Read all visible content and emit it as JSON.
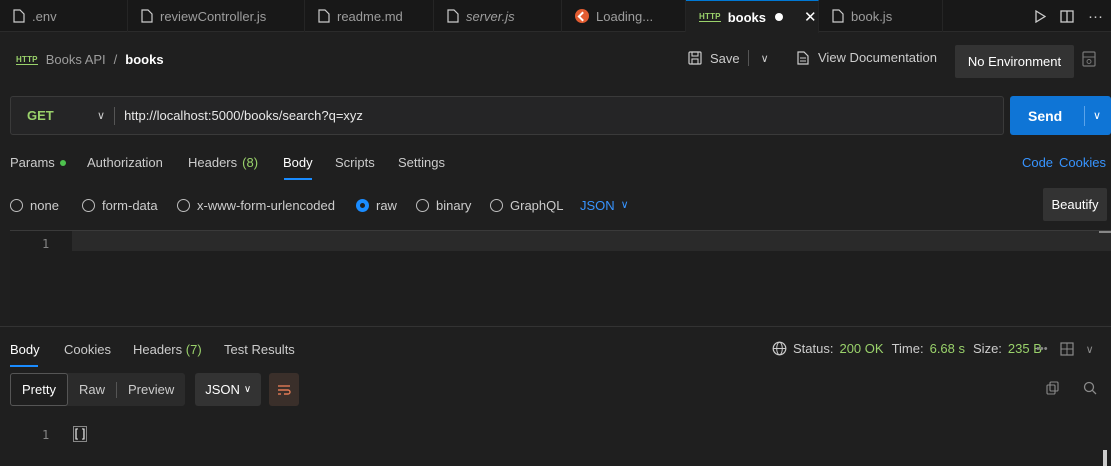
{
  "tabs": [
    {
      "label": ".env",
      "icon": "file-icon",
      "style": "normal"
    },
    {
      "label": "reviewController.js",
      "icon": "file-icon",
      "style": "normal"
    },
    {
      "label": "readme.md",
      "icon": "file-icon",
      "style": "normal"
    },
    {
      "label": "server.js",
      "icon": "file-icon",
      "style": "italic"
    },
    {
      "label": "Loading...",
      "icon": "loading-icon",
      "style": "normal"
    },
    {
      "label": "books",
      "icon": "http-icon",
      "style": "bold"
    },
    {
      "label": "book.js",
      "icon": "file-icon",
      "style": "normal"
    }
  ],
  "http_badge": "HTTP",
  "breadcrumb": {
    "parent": "Books API",
    "separator": "/",
    "current": "books"
  },
  "header": {
    "save_label": "Save",
    "view_doc_label": "View Documentation",
    "environment": "No Environment"
  },
  "request": {
    "method": "GET",
    "url": "http://localhost:5000/books/search?q=xyz",
    "send_label": "Send"
  },
  "request_tabs": {
    "params": "Params",
    "authorization": "Authorization",
    "headers": "Headers",
    "headers_count": "(8)",
    "body": "Body",
    "scripts": "Scripts",
    "settings": "Settings",
    "code": "Code",
    "cookies": "Cookies"
  },
  "body_types": {
    "none": "none",
    "form_data": "form-data",
    "urlencoded": "x-www-form-urlencoded",
    "raw": "raw",
    "binary": "binary",
    "graphql": "GraphQL",
    "format": "JSON",
    "beautify": "Beautify",
    "selected": "raw"
  },
  "editor": {
    "line_number": "1"
  },
  "response_tabs": {
    "body": "Body",
    "cookies": "Cookies",
    "headers": "Headers",
    "headers_count": "(7)",
    "test_results": "Test Results"
  },
  "response_status": {
    "status_label": "Status:",
    "status_value": "200 OK",
    "time_label": "Time:",
    "time_value": "6.68 s",
    "size_label": "Size:",
    "size_value": "235 B"
  },
  "response_view": {
    "pretty": "Pretty",
    "raw": "Raw",
    "preview": "Preview",
    "format": "JSON"
  },
  "response_body": {
    "line_number": "1",
    "content": "[]"
  },
  "colors": {
    "accent": "#0f75d6",
    "method": "#9ad26b",
    "link": "#3794ff"
  }
}
